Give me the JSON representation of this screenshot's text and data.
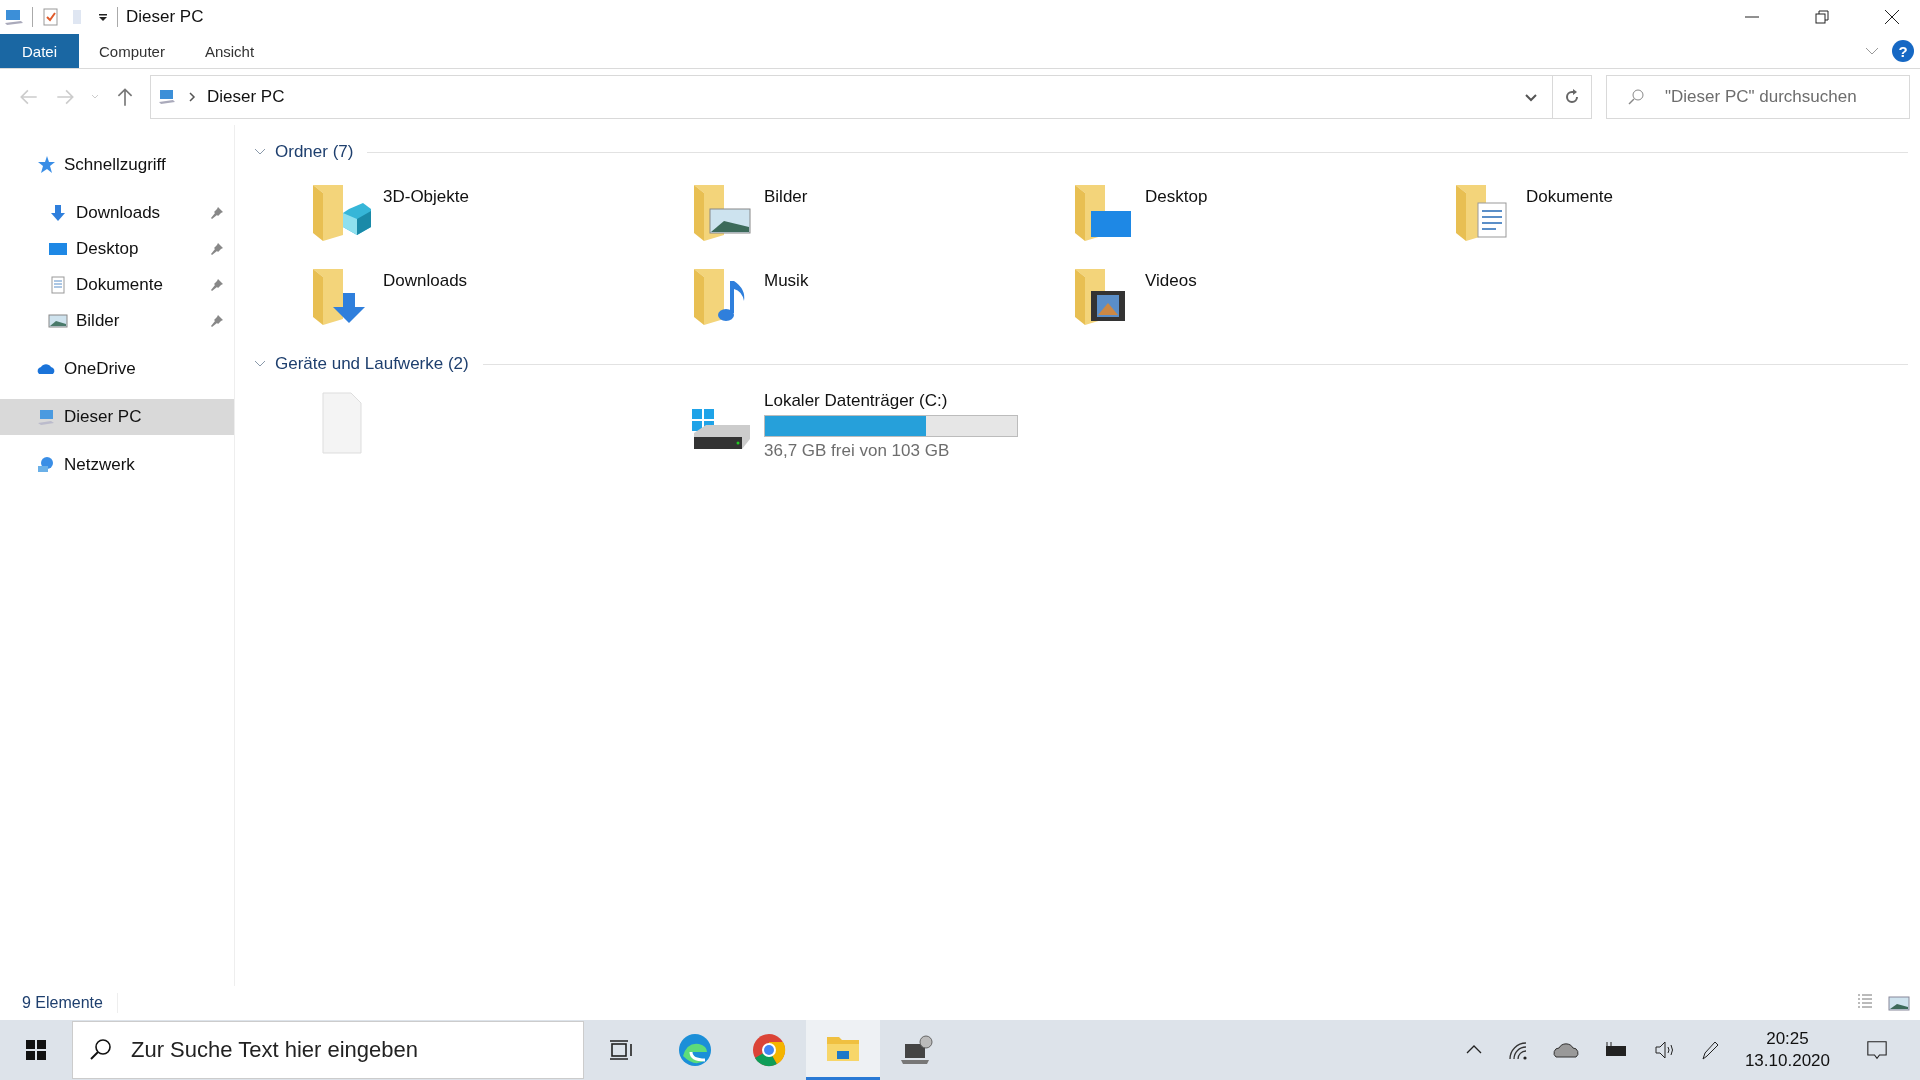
{
  "window": {
    "title": "Dieser PC"
  },
  "ribbon_tabs": [
    {
      "label": "Datei",
      "selected": true
    },
    {
      "label": "Computer",
      "selected": false
    },
    {
      "label": "Ansicht",
      "selected": false
    }
  ],
  "help_button": {
    "label": "?"
  },
  "address_bar": {
    "path": "Dieser PC"
  },
  "search": {
    "placeholder": "\"Dieser PC\" durchsuchen"
  },
  "sidebar": {
    "items": [
      {
        "label": "Schnellzugriff",
        "kind": "star",
        "selected": false,
        "children": [
          {
            "label": "Downloads",
            "kind": "download",
            "selected": false,
            "pinned": true
          },
          {
            "label": "Desktop",
            "kind": "desktop",
            "selected": false,
            "pinned": true
          },
          {
            "label": "Dokumente",
            "kind": "document",
            "selected": false,
            "pinned": true
          },
          {
            "label": "Bilder",
            "kind": "picture",
            "selected": false,
            "pinned": true
          }
        ]
      },
      {
        "label": "OneDrive",
        "kind": "cloud",
        "selected": false
      },
      {
        "label": "Dieser PC",
        "kind": "pc",
        "selected": true
      },
      {
        "label": "Netzwerk",
        "kind": "network",
        "selected": false
      }
    ]
  },
  "sections": [
    {
      "title": "Ordner (7)",
      "expanded": true,
      "items": [
        {
          "kind": "cube",
          "label": "3D-Objekte"
        },
        {
          "kind": "picture",
          "label": "Bilder"
        },
        {
          "kind": "desktop",
          "label": "Desktop"
        },
        {
          "kind": "document",
          "label": "Dokumente"
        },
        {
          "kind": "download",
          "label": "Downloads"
        },
        {
          "kind": "music",
          "label": "Musik"
        },
        {
          "kind": "video",
          "label": "Videos"
        }
      ]
    },
    {
      "title": "Geräte und Laufwerke (2)",
      "expanded": true,
      "items": [
        {
          "kind": "blank"
        },
        {
          "kind": "drive",
          "label": "Lokaler Datenträger (C:)",
          "level": 0.64,
          "reading": "36,7 GB frei von 103 GB"
        }
      ]
    }
  ],
  "status_bar": {
    "count": "9 Elemente"
  },
  "taskbar": {
    "search_placeholder": "Zur Suche Text hier eingeben",
    "apps": [
      {
        "kind": "taskview",
        "active": false
      },
      {
        "kind": "edge",
        "active": false
      },
      {
        "kind": "chrome",
        "active": false
      },
      {
        "kind": "explorer",
        "active": true
      },
      {
        "kind": "laptop",
        "active": false
      }
    ],
    "time": "20:25",
    "date": "13.10.2020"
  }
}
